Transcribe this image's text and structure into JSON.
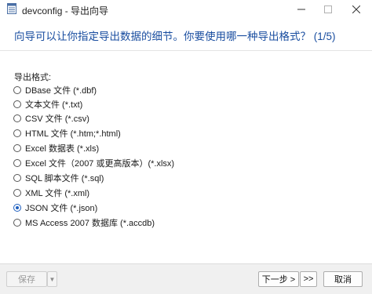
{
  "window": {
    "title": "devconfig - 导出向导",
    "minimize_glyph": "—",
    "maximize_glyph": "☐",
    "close_glyph": "✕"
  },
  "heading": "向导可以让你指定导出数据的细节。你要使用哪一种导出格式？ (1/5)",
  "group_label": "导出格式:",
  "options": [
    {
      "label": "DBase 文件 (*.dbf)",
      "selected": false
    },
    {
      "label": "文本文件 (*.txt)",
      "selected": false
    },
    {
      "label": "CSV 文件 (*.csv)",
      "selected": false
    },
    {
      "label": "HTML 文件 (*.htm;*.html)",
      "selected": false
    },
    {
      "label": "Excel 数据表 (*.xls)",
      "selected": false
    },
    {
      "label": "Excel 文件（2007 或更高版本）(*.xlsx)",
      "selected": false
    },
    {
      "label": "SQL 脚本文件 (*.sql)",
      "selected": false
    },
    {
      "label": "XML 文件 (*.xml)",
      "selected": false
    },
    {
      "label": "JSON 文件 (*.json)",
      "selected": true
    },
    {
      "label": "MS Access 2007 数据库 (*.accdb)",
      "selected": false
    }
  ],
  "footer": {
    "save_label": "保存",
    "save_dropdown_glyph": "▼",
    "next_label": "下一步 >",
    "finish_label": ">>",
    "cancel_label": "取消"
  },
  "colors": {
    "heading": "#1a4ea0",
    "accent": "#1f5fbf"
  }
}
